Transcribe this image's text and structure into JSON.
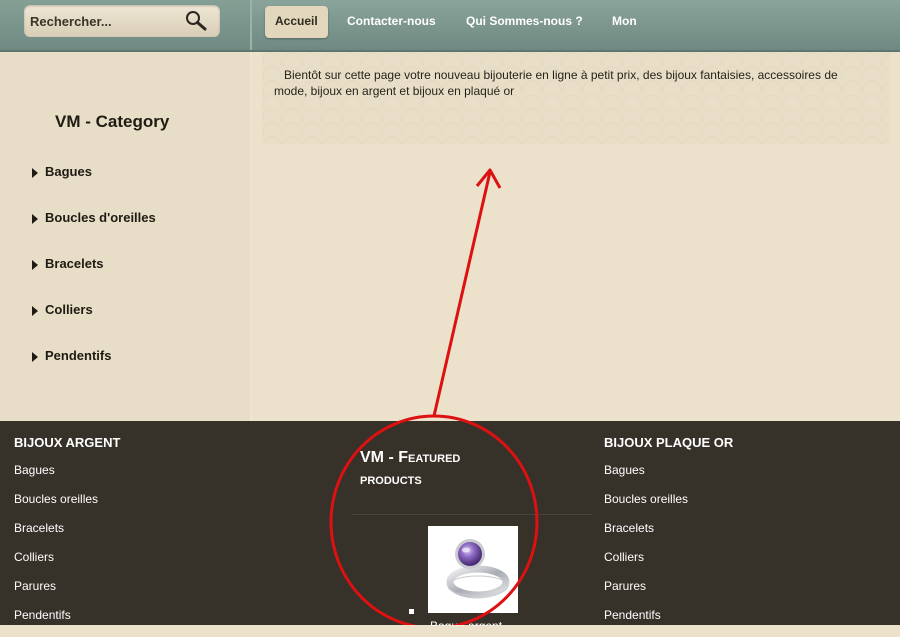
{
  "search": {
    "placeholder": "Rechercher...",
    "icon": "search-icon"
  },
  "nav": {
    "items": [
      {
        "label": "Accueil",
        "active": true
      },
      {
        "label": "Contacter-nous",
        "active": false
      },
      {
        "label": "Qui Sommes-nous ?",
        "active": false
      },
      {
        "label": "Mon",
        "active": false
      }
    ]
  },
  "sidebar": {
    "title": "VM - Category",
    "items": [
      {
        "label": "Bagues"
      },
      {
        "label": "Boucles d'oreilles"
      },
      {
        "label": "Bracelets"
      },
      {
        "label": "Colliers"
      },
      {
        "label": "Pendentifs"
      }
    ]
  },
  "main": {
    "intro": "Bientôt sur cette page votre nouveau bijouterie en ligne à petit prix, des bijoux fantaisies, accessoires de mode, bijoux en argent et bijoux en plaqué or"
  },
  "footer": {
    "left": {
      "title": "BIJOUX ARGENT",
      "items": [
        "Bagues",
        "Boucles oreilles",
        "Bracelets",
        "Colliers",
        "Parures",
        "Pendentifs"
      ]
    },
    "featured": {
      "title_line1": "VM - Featured",
      "title_line2": "products",
      "product_name": "Bague argent"
    },
    "right": {
      "title": "BIJOUX PLAQUE OR",
      "items": [
        "Bagues",
        "Boucles oreilles",
        "Bracelets",
        "Colliers",
        "Parures",
        "Pendentifs"
      ]
    }
  },
  "colors": {
    "topbar": "#7a958d",
    "footer": "#363129",
    "annotation": "#dd1111"
  }
}
